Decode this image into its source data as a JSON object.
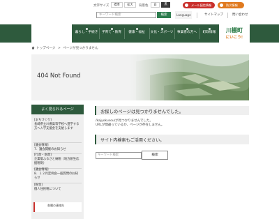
{
  "utility": {
    "text_size_label": "文字サイズ",
    "size_standard": "標準",
    "size_large": "拡大",
    "bg_color_label": "背景色",
    "bg_white": "白",
    "bg_black": "黒",
    "search_placeholder": "キーワード検索",
    "search_button": "検索",
    "mail_service": "メール配信情報",
    "disaster_info": "防災情報",
    "language": "Language",
    "sitemap": "サイトマップ",
    "contact": "問い合わせ"
  },
  "nav": {
    "items": [
      {
        "label": "暮らし・手続き"
      },
      {
        "label": "子育て・教育"
      },
      {
        "label": "健康・福祉"
      },
      {
        "label": "文化・スポーツ"
      },
      {
        "label": "事業者の方へ"
      },
      {
        "label": "町政情報"
      }
    ],
    "mascot_line1": "川棚町",
    "mascot_line2": "にいこう!"
  },
  "breadcrumb": {
    "home": "トップページ",
    "separator": ">",
    "current": "ページが見つかりません"
  },
  "hero": {
    "title": "404 Not Found"
  },
  "sidebar": {
    "heading": "よく見られるページ",
    "items": [
      {
        "text": "[まちづくり]\n長崎県立川棚高等学校へ進学する方へ入学支援金を支給します"
      },
      {
        "text": "[議会情報]\n7．議会開催のお知らせ"
      },
      {
        "text": "[行政・財政]\n企業版ふるさと納税（地方創生応援税制）"
      },
      {
        "text": "[議会情報]\n8．１２月定例会一般質問のお知らせ"
      },
      {
        "text": "[税金]\n個人住民税について"
      }
    ],
    "bottom_box": "各種の連絡先"
  },
  "content": {
    "heading": "お探しのページは見つかりませんでした。",
    "message_line1": "/kajyokusou/が見つかりませんでした。",
    "message_line2": "URLが間違っているか、ページが存在しません。",
    "search_heading": "サイト内検索もご活用ください。",
    "search_placeholder": "キーワード検索",
    "search_button": "検索"
  },
  "colors": {
    "brand_green": "#2e5a3d",
    "button_green": "#2e7d4f",
    "mail_pill": "#c9302c",
    "disaster_pill": "#e07a1f"
  }
}
